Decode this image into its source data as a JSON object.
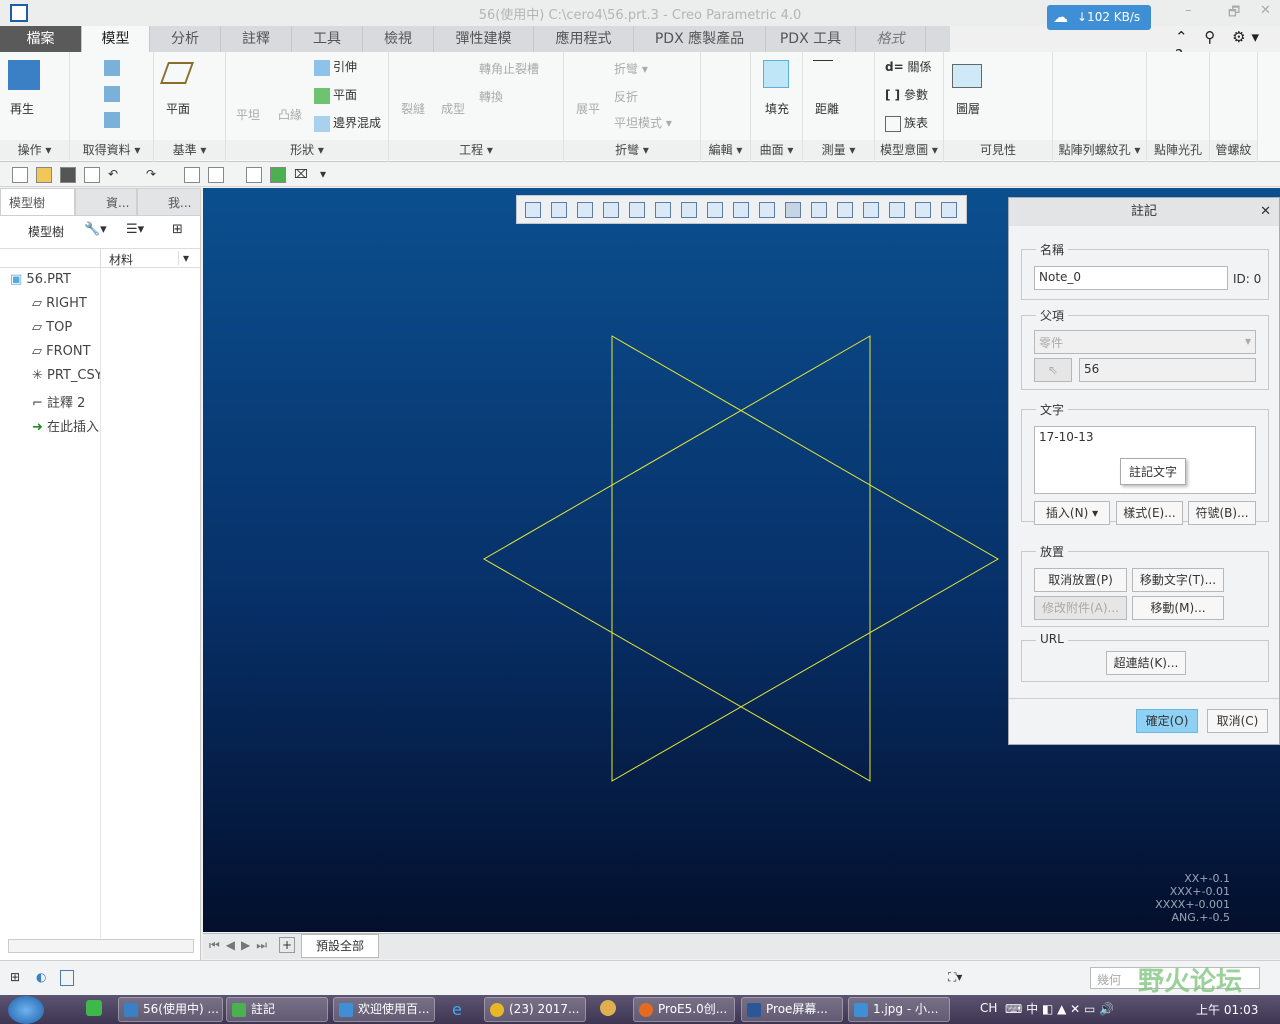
{
  "titlebar": {
    "title": "56(使用中) C:\\cero4\\56.prt.3 - Creo Parametric 4.0",
    "net_speed": "↓102 KB/s",
    "minimize": "–",
    "restore": "🗗",
    "close": "✕"
  },
  "tabs": [
    {
      "label": "檔案"
    },
    {
      "label": "模型"
    },
    {
      "label": "分析"
    },
    {
      "label": "註釋"
    },
    {
      "label": "工具"
    },
    {
      "label": "檢視"
    },
    {
      "label": "彈性建模"
    },
    {
      "label": "應用程式"
    },
    {
      "label": "PDX 應製產品"
    },
    {
      "label": "PDX 工具"
    },
    {
      "label": "格式"
    }
  ],
  "active_tab": "模型",
  "help_icons": "⌃ ⚲ ⚙▾ ?",
  "ribbon": {
    "groups": [
      {
        "label": "操作 ▾",
        "items": [
          "再生"
        ]
      },
      {
        "label": "取得資料 ▾",
        "items": []
      },
      {
        "label": "基準 ▾",
        "items": [
          "平面"
        ]
      },
      {
        "label": "形狀 ▾",
        "items": [
          "平坦",
          "凸緣",
          "引伸",
          "平面",
          "邊界混成"
        ]
      },
      {
        "label": "工程 ▾",
        "items": [
          "裂縫",
          "成型",
          "轉角止裂槽",
          "轉換"
        ]
      },
      {
        "label": "折彎 ▾",
        "items": [
          "展平",
          "折彎 ▾",
          "反折",
          "平坦模式 ▾"
        ]
      },
      {
        "label": "編輯 ▾",
        "items": []
      },
      {
        "label": "曲面 ▾",
        "items": [
          "填充"
        ]
      },
      {
        "label": "測量 ▾",
        "items": [
          "距離"
        ]
      },
      {
        "label": "模型意圖 ▾",
        "items": [
          "關係",
          "參數",
          "族表"
        ]
      },
      {
        "label": "可見性",
        "items": [
          "圖層"
        ]
      },
      {
        "label": "點陣列螺紋孔 ▾",
        "items": []
      },
      {
        "label": "點陣光孔",
        "items": []
      },
      {
        "label": "管螺紋",
        "items": []
      }
    ]
  },
  "left_panel": {
    "tabs": [
      "模型樹",
      "資...",
      "我..."
    ],
    "toolbar_label": "模型樹",
    "column": "材料",
    "tree": [
      {
        "label": "56.PRT",
        "icon": "part-icon"
      },
      {
        "label": "RIGHT",
        "icon": "datum-plane-icon"
      },
      {
        "label": "TOP",
        "icon": "datum-plane-icon"
      },
      {
        "label": "FRONT",
        "icon": "datum-plane-icon"
      },
      {
        "label": "PRT_CSYS",
        "icon": "csys-icon"
      },
      {
        "label": "註釋 2",
        "icon": "note-icon"
      },
      {
        "label": "在此插入",
        "icon": "insert-arrow-icon"
      }
    ]
  },
  "canvas": {
    "tolerances": [
      "XX+-0.1",
      "XXX+-0.01",
      "XXXX+-0.001",
      "ANG.+-0.5"
    ],
    "line_color": "#e6e632",
    "bg_top": "#0b4f8f",
    "bg_bottom": "#040f2c"
  },
  "bottom_tabs": {
    "label": "預設全部"
  },
  "status": {
    "filter_placeholder": "幾何"
  },
  "dialog": {
    "title": "註記",
    "name_legend": "名稱",
    "name_value": "Note_0",
    "id": "ID: 0",
    "parent_legend": "父項",
    "parent_type": "零件",
    "parent_value": "56",
    "text_legend": "文字",
    "text_value": "17-10-13",
    "tooltip": "註記文字",
    "insert": "插入(N)",
    "style": "樣式(E)...",
    "symbol": "符號(B)...",
    "placement_legend": "放置",
    "unplace": "取消放置(P)",
    "move_text": "移動文字(T)...",
    "modify_attach": "修改附件(A)...",
    "move": "移動(M)...",
    "url_legend": "URL",
    "hyperlink": "超連結(K)...",
    "ok": "確定(O)",
    "cancel": "取消(C)"
  },
  "taskbar": {
    "items": [
      "56(使用中) ...",
      "註記",
      "欢迎使用百...",
      "(23) 2017...",
      "ProE5.0创...",
      "Proe屏幕...",
      "1.jpg - 小..."
    ],
    "tray": "CH",
    "clock": "上午 01:03"
  },
  "watermark": "野火论坛"
}
